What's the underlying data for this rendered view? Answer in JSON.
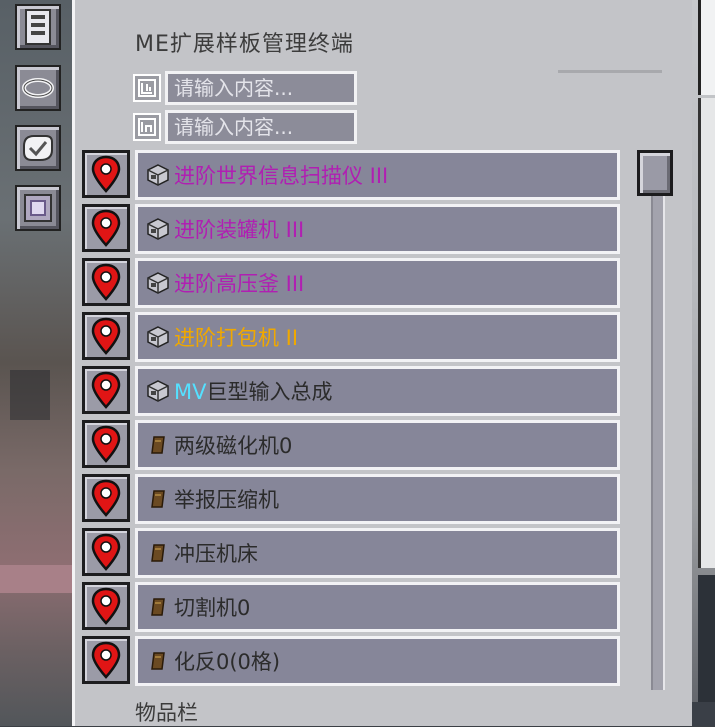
{
  "window": {
    "title": "ME扩展样板管理终端",
    "inventory_label": "物品栏"
  },
  "search": {
    "input_filter": {
      "placeholder": "请输入内容...",
      "icon": "input-filter-icon"
    },
    "output_filter": {
      "placeholder": "请输入内容...",
      "icon": "output-filter-icon"
    }
  },
  "toolbar": [
    {
      "name": "terminal-style-icon"
    },
    {
      "name": "ring-icon"
    },
    {
      "name": "pattern-hand-icon"
    },
    {
      "name": "interface-block-icon"
    }
  ],
  "items": [
    {
      "parts": [
        {
          "text": "进阶世界信息扫描仪 III",
          "color": "#b01fb2"
        }
      ],
      "icon": "machine-casing-icon"
    },
    {
      "parts": [
        {
          "text": "进阶装罐机 III",
          "color": "#b01fb2"
        }
      ],
      "icon": "machine-casing-icon"
    },
    {
      "parts": [
        {
          "text": "进阶高压釜 III",
          "color": "#b01fb2"
        }
      ],
      "icon": "machine-casing-icon"
    },
    {
      "parts": [
        {
          "text": "进阶打包机 II",
          "color": "#f0a800"
        }
      ],
      "icon": "machine-casing-icon"
    },
    {
      "parts": [
        {
          "text": "MV",
          "color": "#55e0ff"
        },
        {
          "text": "巨型输入总成",
          "color": "#2b2b2b"
        }
      ],
      "icon": "machine-casing-icon"
    },
    {
      "parts": [
        {
          "text": "两级磁化机0",
          "color": "#2b2b2b"
        }
      ],
      "icon": "book-icon"
    },
    {
      "parts": [
        {
          "text": "举报压缩机",
          "color": "#2b2b2b"
        }
      ],
      "icon": "book-icon"
    },
    {
      "parts": [
        {
          "text": "冲压机床",
          "color": "#2b2b2b"
        }
      ],
      "icon": "book-icon"
    },
    {
      "parts": [
        {
          "text": "切割机0",
          "color": "#2b2b2b"
        }
      ],
      "icon": "book-icon"
    },
    {
      "parts": [
        {
          "text": "化反0(0格)",
          "color": "#2b2b2b"
        }
      ],
      "icon": "book-icon"
    }
  ],
  "colors": {
    "panel": "#c3c4c8",
    "slot": "#868699",
    "pin_red": "#e01515",
    "purple_text": "#b01fb2",
    "orange_text": "#f0a800",
    "cyan_text": "#55e0ff"
  }
}
